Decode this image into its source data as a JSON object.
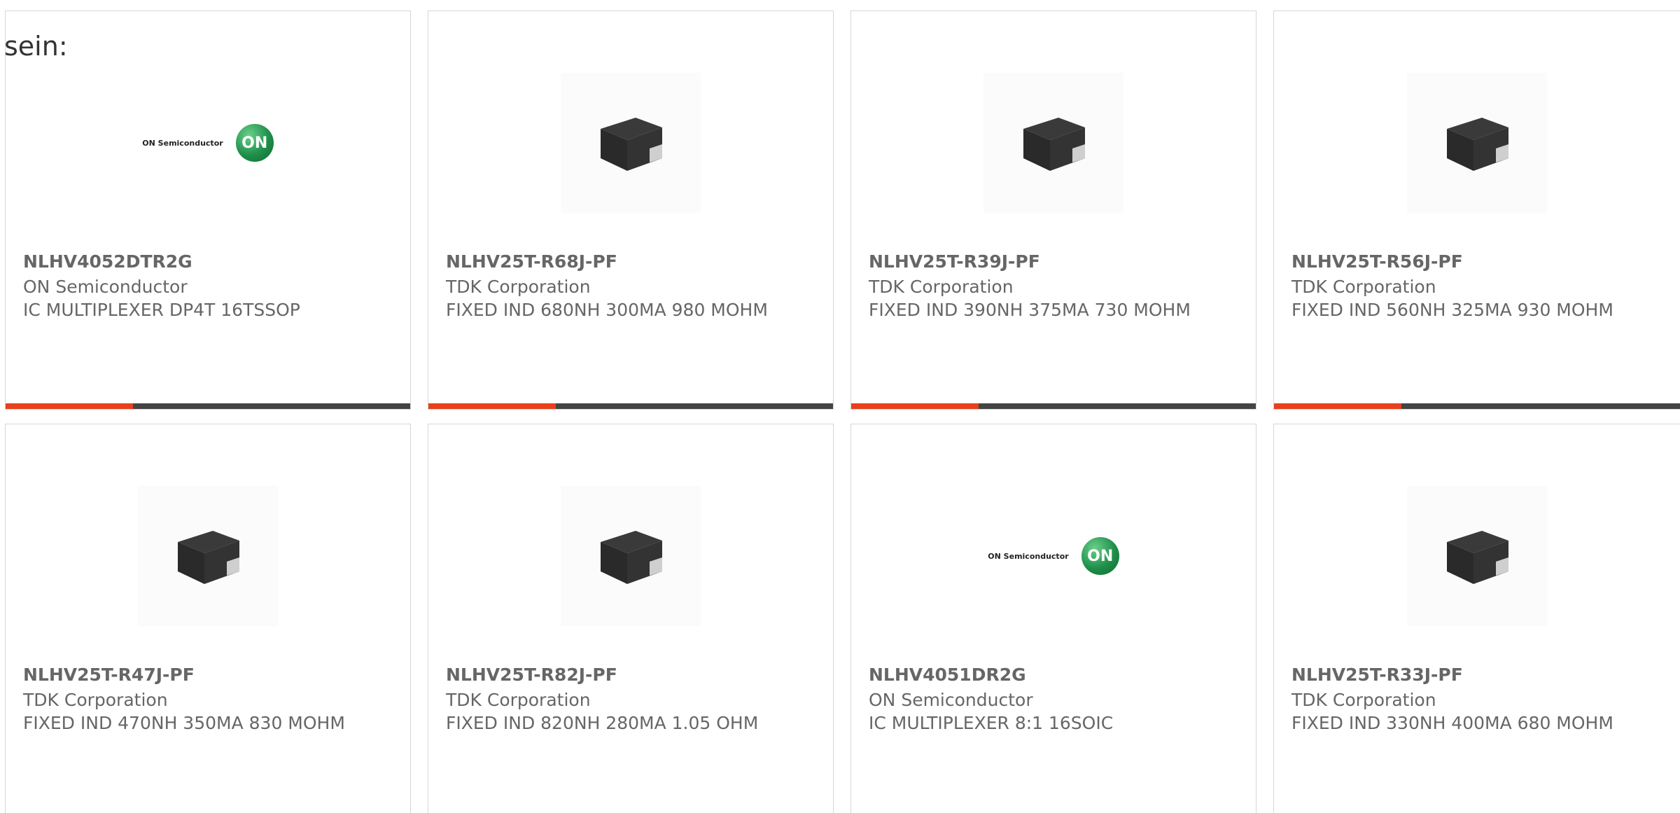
{
  "intro_text": "sein:",
  "colors": {
    "accent": "#e8401c",
    "bar": "#444444",
    "text": "#666666",
    "border": "#d6d6d6"
  },
  "products": [
    {
      "part": "NLHV4052DTR2G",
      "manufacturer": "ON Semiconductor",
      "description": "IC MULTIPLEXER DP4T 16TSSOP",
      "image": "on-semiconductor-logo",
      "logo_text": "ON Semiconductor",
      "logo_mark": "ON"
    },
    {
      "part": "NLHV25T-R68J-PF",
      "manufacturer": "TDK Corporation",
      "description": "FIXED IND 680NH 300MA 980 MOHM",
      "image": "inductor-chip-photo"
    },
    {
      "part": "NLHV25T-R39J-PF",
      "manufacturer": "TDK Corporation",
      "description": "FIXED IND 390NH 375MA 730 MOHM",
      "image": "inductor-chip-photo"
    },
    {
      "part": "NLHV25T-R56J-PF",
      "manufacturer": "TDK Corporation",
      "description": "FIXED IND 560NH 325MA 930 MOHM",
      "image": "inductor-chip-photo"
    },
    {
      "part": "NLHV25T-R47J-PF",
      "manufacturer": "TDK Corporation",
      "description": "FIXED IND 470NH 350MA 830 MOHM",
      "image": "inductor-chip-photo"
    },
    {
      "part": "NLHV25T-R82J-PF",
      "manufacturer": "TDK Corporation",
      "description": "FIXED IND 820NH 280MA 1.05 OHM",
      "image": "inductor-chip-photo"
    },
    {
      "part": "NLHV4051DR2G",
      "manufacturer": "ON Semiconductor",
      "description": "IC MULTIPLEXER 8:1 16SOIC",
      "image": "on-semiconductor-logo",
      "logo_text": "ON Semiconductor",
      "logo_mark": "ON"
    },
    {
      "part": "NLHV25T-R33J-PF",
      "manufacturer": "TDK Corporation",
      "description": "FIXED IND 330NH 400MA 680 MOHM",
      "image": "inductor-chip-photo"
    }
  ]
}
